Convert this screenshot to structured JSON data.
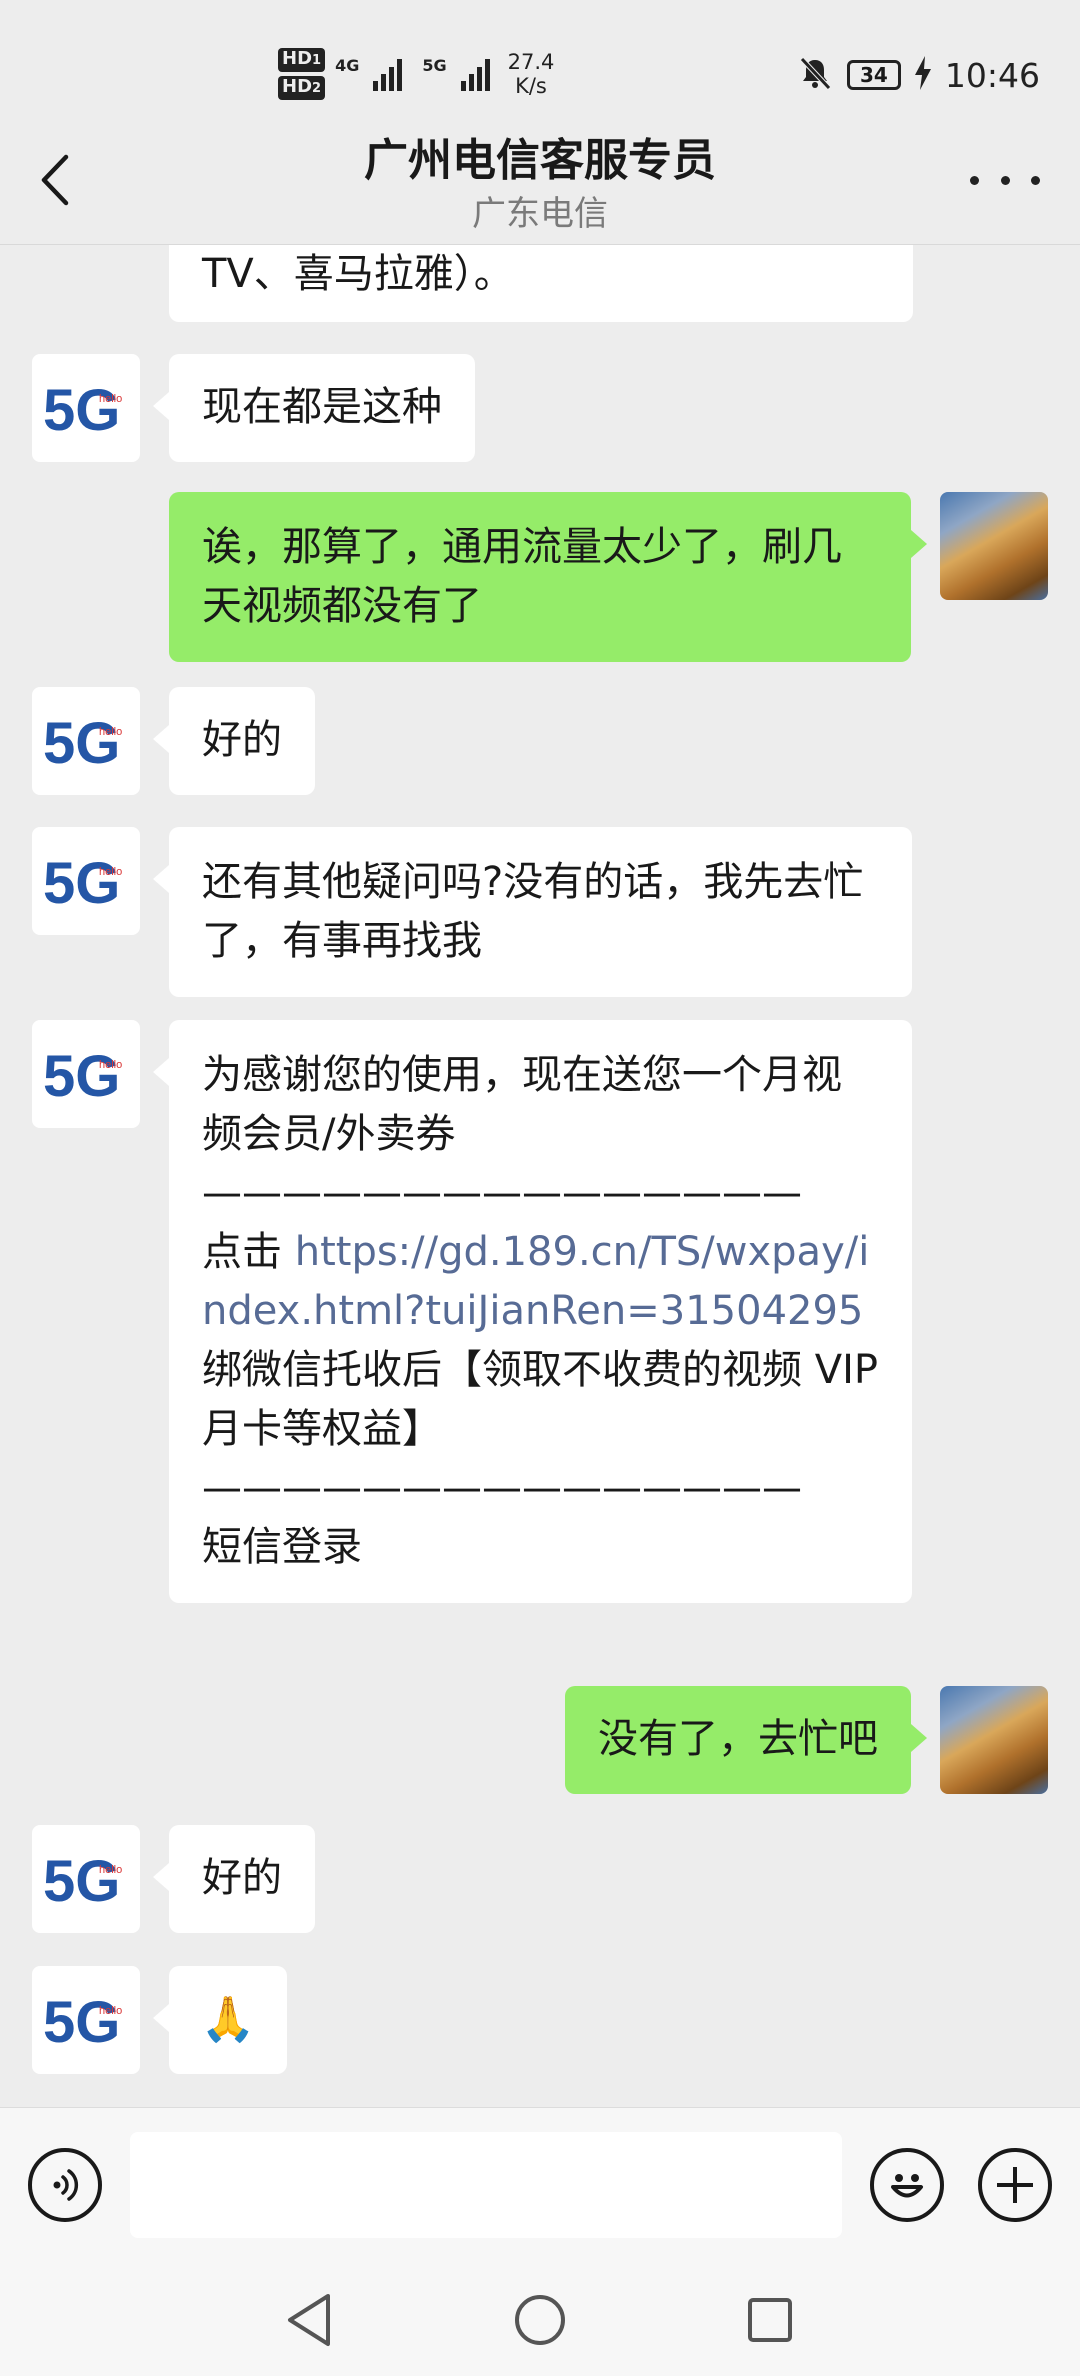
{
  "status_bar": {
    "hd1": "HD",
    "hd1_sub": "1",
    "hd2": "HD",
    "hd2_sub": "2",
    "net1": "4G",
    "net2": "5G",
    "speed_value": "27.4",
    "speed_unit": "K/s",
    "battery": "34",
    "time": "10:46"
  },
  "header": {
    "title": "广州电信客服专员",
    "subtitle": "广东电信"
  },
  "avatar": {
    "service_label": "5G",
    "service_small": "hello"
  },
  "messages": {
    "m0": {
      "text": "TV、喜马拉雅）。"
    },
    "m1": {
      "text": "现在都是这种"
    },
    "m2": {
      "text": "诶，那算了，通用流量太少了，刷几天视频都没有了"
    },
    "m3": {
      "text": "好的"
    },
    "m4": {
      "text": "还有其他疑问吗?没有的话，我先去忙了，有事再找我"
    },
    "m5": {
      "line1": "为感谢您的使用，现在送您一个月视频会员/外卖券",
      "divider": "———————————————",
      "click": "点击 ",
      "link": "https://gd.189.cn/TS/wxpay/index.html?tuiJianRen=31504295",
      "after_link": " 绑微信托收后【领取不收费的视频 VIP 月卡等权益】",
      "divider2": "———————————————",
      "sms_login": "短信登录"
    },
    "m6": {
      "text": "没有了，去忙吧"
    },
    "m7": {
      "text": "好的"
    },
    "m8": {
      "text": "🙏"
    }
  },
  "input": {
    "placeholder": ""
  }
}
